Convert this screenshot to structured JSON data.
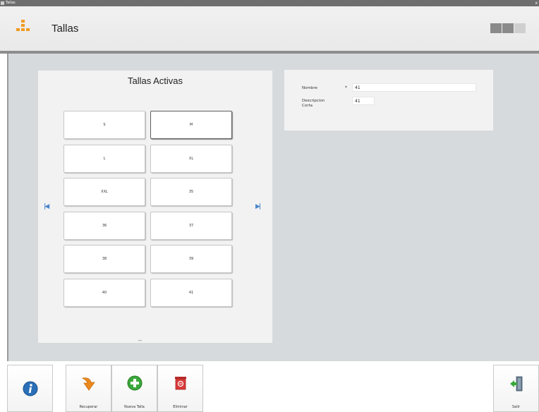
{
  "window": {
    "title_bar_text": "Tallas"
  },
  "header": {
    "title": "Tallas"
  },
  "left_panel": {
    "title": "Tallas Activas",
    "sizes": [
      "S",
      "M",
      "L",
      "XL",
      "XXL",
      "35",
      "36",
      "37",
      "38",
      "39",
      "40",
      "41"
    ],
    "selected": "M",
    "footer_mark": "--"
  },
  "form": {
    "nombre_label": "Nombre",
    "required_mark": "*",
    "nombre_value": "41",
    "descripcion_label_1": "Descripcion",
    "descripcion_label_2": "Corta",
    "descripcion_value": "41"
  },
  "toolbar": {
    "recuperar_label": "Recuperar",
    "nueva_label": "Nueva Talla",
    "eliminar_label": "Eliminar",
    "salir_label": "Salir"
  },
  "icons": {
    "app": "grid-icon",
    "info": "info-icon",
    "recover": "arrow-down-icon",
    "new": "plus-icon",
    "delete": "trash-icon",
    "exit": "exit-door-icon",
    "prev": "first-page-icon",
    "next": "last-page-icon"
  },
  "colors": {
    "accent_orange": "#f19a23",
    "info_blue": "#2a6fb8",
    "new_green": "#3aa83a",
    "delete_red": "#d83a3a",
    "nav_blue": "#4b87c9"
  }
}
